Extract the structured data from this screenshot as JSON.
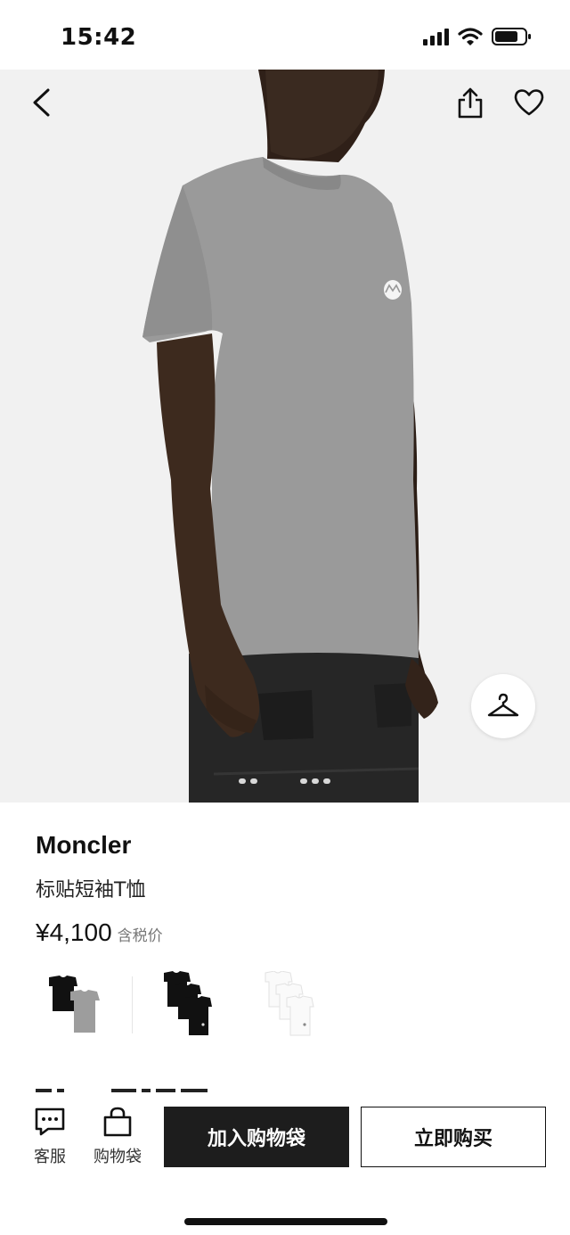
{
  "status": {
    "time": "15:42"
  },
  "product": {
    "brand": "Moncler",
    "name": "标贴短袖T恤",
    "price": "¥4,100",
    "tax_note": "含税价",
    "variants": [
      {
        "label": "black-grey pack"
      },
      {
        "label": "black three pack"
      },
      {
        "label": "white three pack"
      }
    ]
  },
  "bottom_bar": {
    "service_label": "客服",
    "bag_label": "购物袋",
    "add_to_bag": "加入购物袋",
    "buy_now": "立即购买"
  },
  "icons": {
    "back": "chevron-left-icon",
    "share": "share-icon",
    "favorite": "heart-icon",
    "wardrobe": "hanger-icon",
    "service": "chat-icon",
    "bag": "shopping-bag-icon"
  },
  "colors": {
    "primary_button": "#1d1d1d",
    "background": "#ffffff",
    "image_bg": "#f1f1f1"
  }
}
